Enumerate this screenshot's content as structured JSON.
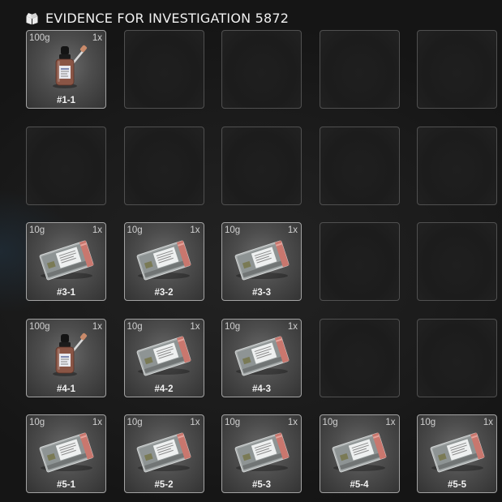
{
  "header": {
    "title": "EVIDENCE FOR INVESTIGATION 5872",
    "icon": "evidence-box-icon"
  },
  "colors": {
    "background": "#1b1b1b",
    "slot_border": "#505050",
    "slot_border_filled": "#a3a3a3",
    "text": "#f0f0f0"
  },
  "slots": [
    {
      "weight": "100g",
      "qty": "1x",
      "label": "#1-1",
      "item": "dropper-bottle"
    },
    null,
    null,
    null,
    null,
    null,
    null,
    null,
    null,
    null,
    {
      "weight": "10g",
      "qty": "1x",
      "label": "#3-1",
      "item": "evidence-bag"
    },
    {
      "weight": "10g",
      "qty": "1x",
      "label": "#3-2",
      "item": "evidence-bag"
    },
    {
      "weight": "10g",
      "qty": "1x",
      "label": "#3-3",
      "item": "evidence-bag"
    },
    null,
    null,
    {
      "weight": "100g",
      "qty": "1x",
      "label": "#4-1",
      "item": "dropper-bottle"
    },
    {
      "weight": "10g",
      "qty": "1x",
      "label": "#4-2",
      "item": "evidence-bag"
    },
    {
      "weight": "10g",
      "qty": "1x",
      "label": "#4-3",
      "item": "evidence-bag"
    },
    null,
    null,
    {
      "weight": "10g",
      "qty": "1x",
      "label": "#5-1",
      "item": "evidence-bag"
    },
    {
      "weight": "10g",
      "qty": "1x",
      "label": "#5-2",
      "item": "evidence-bag"
    },
    {
      "weight": "10g",
      "qty": "1x",
      "label": "#5-3",
      "item": "evidence-bag"
    },
    {
      "weight": "10g",
      "qty": "1x",
      "label": "#5-4",
      "item": "evidence-bag"
    },
    {
      "weight": "10g",
      "qty": "1x",
      "label": "#5-5",
      "item": "evidence-bag"
    }
  ]
}
